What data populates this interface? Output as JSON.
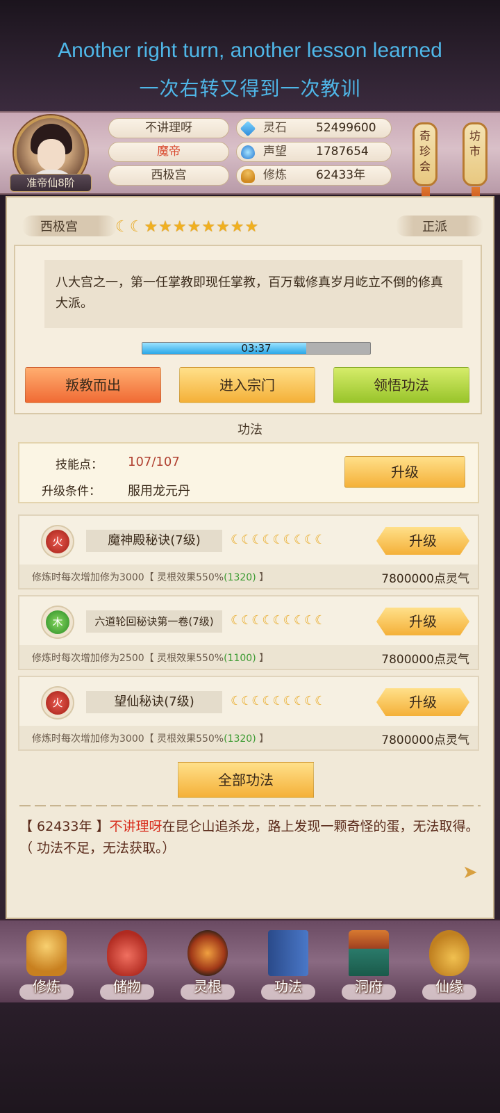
{
  "caption": {
    "english": "Another right turn, another lesson learned",
    "chinese": "一次右转又得到一次教训"
  },
  "header": {
    "rank": "准帝仙8阶",
    "player_name": "不讲理呀",
    "title": "魔帝",
    "sect": "西极宫",
    "stats": [
      {
        "label": "灵石",
        "value": "52499600",
        "icon": "spirit-stone-icon"
      },
      {
        "label": "声望",
        "value": "1787654",
        "icon": "fame-crystal-icon"
      },
      {
        "label": "修炼",
        "value": "62433年",
        "icon": "meditation-icon"
      }
    ],
    "lanterns": [
      {
        "label_top": "奇",
        "label_mid": "珍",
        "label_bot": "会"
      },
      {
        "label_top": "坊",
        "label_mid": "",
        "label_bot": "市"
      }
    ]
  },
  "sect_panel": {
    "name": "西极宫",
    "alignment": "正派",
    "moons": 2,
    "stars": 8,
    "description": "八大宫之一，第一任掌教即现任掌教，百万载修真岁月屹立不倒的修真大派。",
    "timer": "03:37",
    "timer_progress": 0.72,
    "buttons": {
      "leave": "叛教而出",
      "enter": "进入宗门",
      "comprehend": "领悟功法"
    }
  },
  "gongfa": {
    "section_title": "功法",
    "skill_points_label": "技能点：",
    "skill_points_value": "107/107",
    "upgrade_condition_label": "升级条件：",
    "upgrade_condition_value": "服用龙元丹",
    "upgrade_button": "升级",
    "skills": [
      {
        "element": "火",
        "name": "魔神殿秘诀(7级)",
        "moons": 9,
        "upgrade_label": "升级",
        "info_prefix": "修炼时每次增加修为3000【 灵根效果550%",
        "info_green": "(1320)",
        "info_suffix": " 】",
        "cost": "7800000点灵气"
      },
      {
        "element": "木",
        "name": "六道轮回秘诀第一卷(7级)",
        "moons": 9,
        "upgrade_label": "升级",
        "info_prefix": "修炼时每次增加修为2500【 灵根效果550%",
        "info_green": "(1100)",
        "info_suffix": " 】",
        "cost": "7800000点灵气"
      },
      {
        "element": "火",
        "name": "望仙秘诀(7级)",
        "moons": 9,
        "upgrade_label": "升级",
        "info_prefix": "修炼时每次增加修为3000【 灵根效果550%",
        "info_green": "(1320)",
        "info_suffix": " 】",
        "cost": "7800000点灵气"
      }
    ],
    "all_button": "全部功法"
  },
  "log": {
    "year": "【 62433年 】",
    "name": "不讲理呀",
    "text": "在昆仑山追杀龙，路上发现一颗奇怪的蛋，无法取得。（ 功法不足，无法获取。）"
  },
  "nav": {
    "items": [
      {
        "label": "修炼",
        "icon": "meditation-figure-icon"
      },
      {
        "label": "储物",
        "icon": "treasure-bag-icon"
      },
      {
        "label": "灵根",
        "icon": "spirit-root-icon"
      },
      {
        "label": "功法",
        "icon": "scroll-book-icon"
      },
      {
        "label": "洞府",
        "icon": "cave-palace-icon"
      },
      {
        "label": "仙缘",
        "icon": "gourd-icon"
      }
    ]
  },
  "colors": {
    "caption_text": "#4fb7e8",
    "accent_red": "#d84a30",
    "gold": "#f4b038",
    "green_value": "#3a9a30"
  }
}
